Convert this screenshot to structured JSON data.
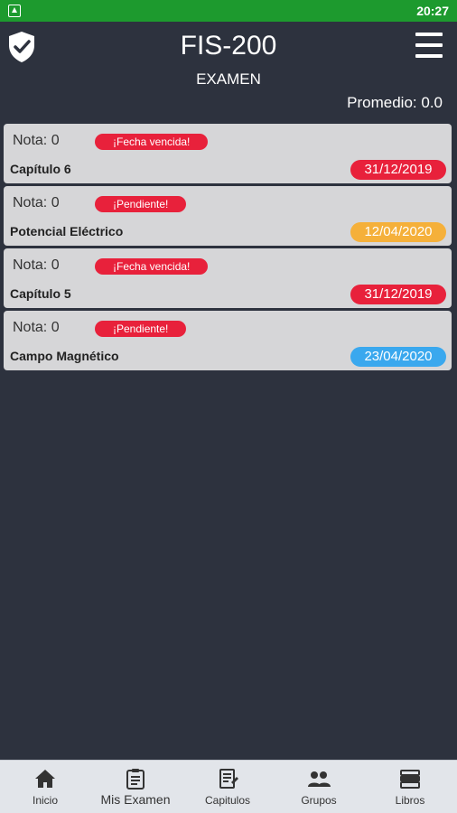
{
  "status_bar": {
    "time": "20:27"
  },
  "header": {
    "title": "FIS-200",
    "subtitle": "EXAMEN",
    "promedio": "Promedio: 0.0"
  },
  "exams": [
    {
      "nota": "Nota: 0",
      "status": "¡Fecha vencida!",
      "name": "Capítulo 6",
      "date": "31/12/2019",
      "date_color": "#e8213b"
    },
    {
      "nota": "Nota: 0",
      "status": "¡Pendiente!",
      "name": "Potencial Eléctrico",
      "date": "12/04/2020",
      "date_color": "#f5b03a"
    },
    {
      "nota": "Nota: 0",
      "status": "¡Fecha vencida!",
      "name": "Capítulo 5",
      "date": "31/12/2019",
      "date_color": "#e8213b"
    },
    {
      "nota": "Nota: 0",
      "status": "¡Pendiente!",
      "name": "Campo Magnético",
      "date": "23/04/2020",
      "date_color": "#3aa8ee"
    }
  ],
  "bottom_nav": [
    {
      "label": "Inicio",
      "icon": "home-icon"
    },
    {
      "label": "Mis Examen",
      "icon": "exam-icon"
    },
    {
      "label": "Capitulos",
      "icon": "chapters-icon"
    },
    {
      "label": "Grupos",
      "icon": "groups-icon"
    },
    {
      "label": "Libros",
      "icon": "books-icon"
    }
  ],
  "colors": {
    "background": "#2d323e",
    "status_bar": "#1d9a2e",
    "badge": "#e8213b",
    "card": "#d6d6d8"
  }
}
